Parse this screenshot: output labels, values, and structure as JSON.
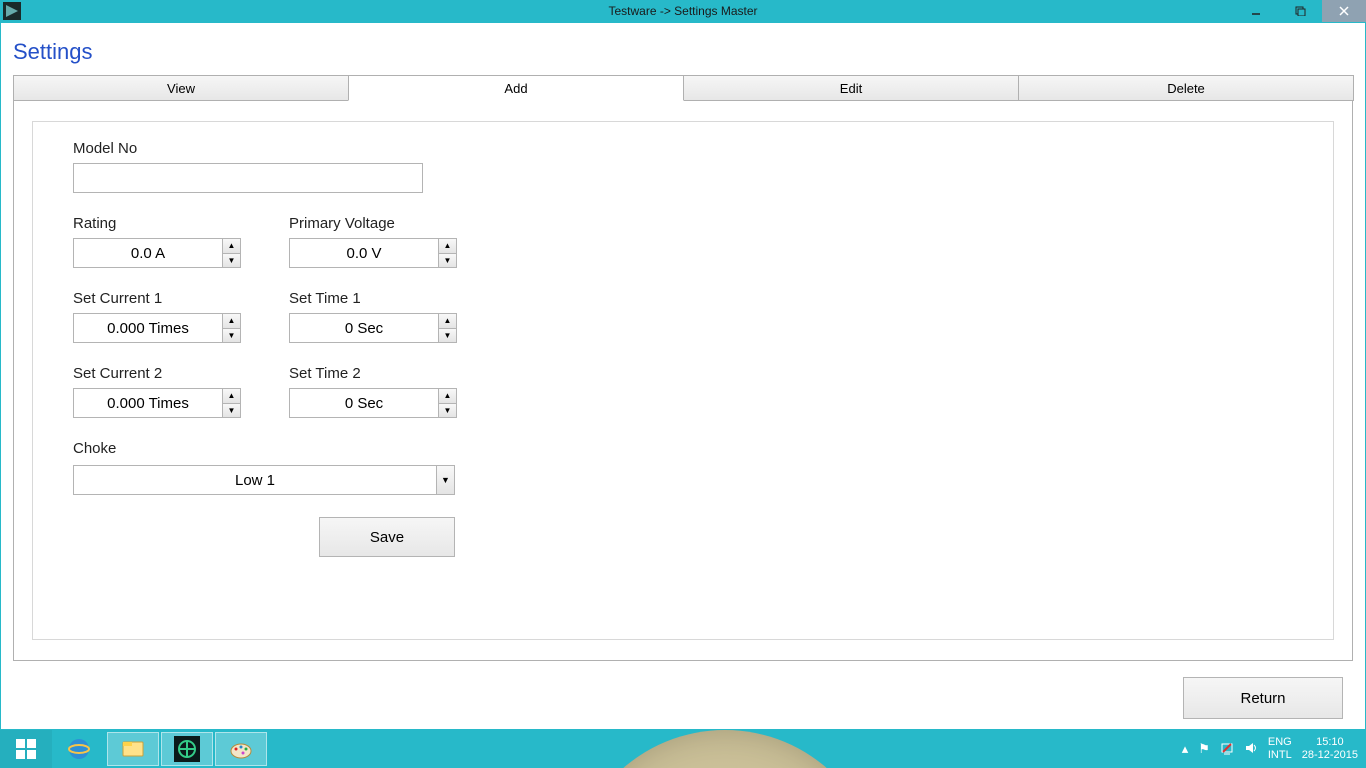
{
  "window": {
    "title": "Testware -> Settings Master"
  },
  "page": {
    "heading": "Settings"
  },
  "tabs": {
    "view": {
      "label": "View"
    },
    "add": {
      "label": "Add"
    },
    "edit": {
      "label": "Edit"
    },
    "delete": {
      "label": "Delete"
    }
  },
  "form": {
    "model_no": {
      "label": "Model No",
      "value": ""
    },
    "rating": {
      "label": "Rating",
      "value": "0.0 A"
    },
    "primary_voltage": {
      "label": "Primary Voltage",
      "value": "0.0 V"
    },
    "set_current_1": {
      "label": "Set Current 1",
      "value": "0.000 Times"
    },
    "set_time_1": {
      "label": "Set Time 1",
      "value": "0 Sec"
    },
    "set_current_2": {
      "label": "Set Current 2",
      "value": "0.000 Times"
    },
    "set_time_2": {
      "label": "Set Time 2",
      "value": "0 Sec"
    },
    "choke": {
      "label": "Choke",
      "value": "Low 1"
    },
    "save_label": "Save"
  },
  "footer": {
    "return_label": "Return"
  },
  "taskbar": {
    "lang1": "ENG",
    "lang2": "INTL",
    "time": "15:10",
    "date": "28-12-2015"
  }
}
